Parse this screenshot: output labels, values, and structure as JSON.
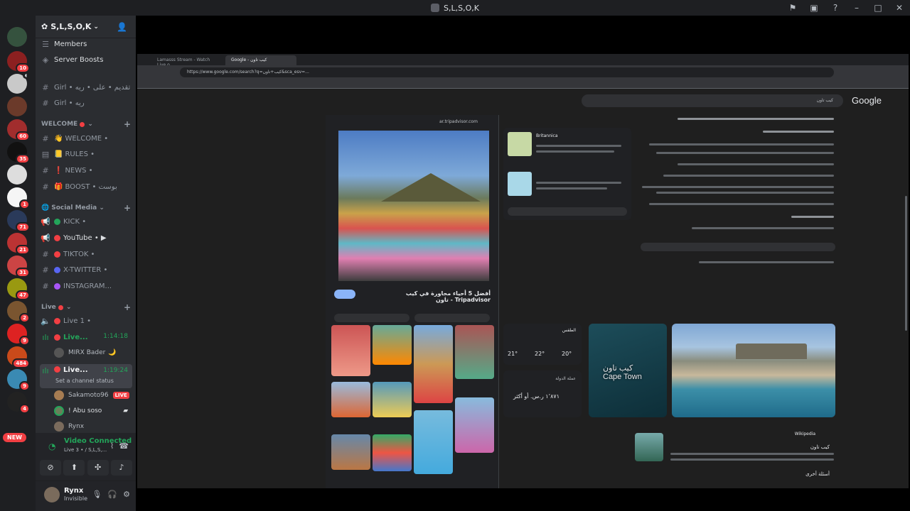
{
  "window": {
    "title": "S,L,S,O,K",
    "controls": [
      "flag-icon",
      "inbox-icon",
      "help-icon",
      "minimize-icon",
      "maximize-icon",
      "close-icon"
    ]
  },
  "guilds": [
    {
      "badge": "10"
    },
    {
      "badge": ""
    },
    {
      "badge": ""
    },
    {
      "badge": "60"
    },
    {
      "badge": "35"
    },
    {
      "badge": ""
    },
    {
      "badge": "1"
    },
    {
      "badge": "71"
    },
    {
      "badge": "21"
    },
    {
      "badge": "31"
    },
    {
      "badge": "47"
    },
    {
      "badge": "2"
    },
    {
      "badge": "9"
    },
    {
      "badge": "484"
    },
    {
      "badge": "9"
    },
    {
      "badge": "4"
    }
  ],
  "new_pill": "NEW",
  "server": {
    "name": "S,L,S,O,K",
    "members": "Members",
    "boosts": "Server Boosts"
  },
  "channels": {
    "top": [
      {
        "name": "Girl • تقديم • على • ريه"
      },
      {
        "name": "Girl • ريه"
      }
    ],
    "welcome": {
      "label": "WELCOME",
      "items": [
        {
          "name": "WELCOME •"
        },
        {
          "name": "RULES •"
        },
        {
          "name": "NEWS •"
        },
        {
          "name": "BOOST • بوست"
        }
      ]
    },
    "social": {
      "label": "Social Media",
      "items": [
        {
          "name": "KICK •",
          "color": "#23a55a"
        },
        {
          "name": "YouTube • ▶",
          "color": "#f23f43"
        },
        {
          "name": "TIKTOK •",
          "color": "#f23f43"
        },
        {
          "name": "X-TWITTER •",
          "color": "#5865f2"
        },
        {
          "name": "INSTAGRAM...",
          "color": "#a855f7"
        }
      ]
    },
    "live": {
      "label": "Live",
      "items": [
        {
          "name": "Live 1 •"
        },
        {
          "name": "Live...",
          "time": "1:14:18"
        },
        {
          "name": "Live...",
          "time": "1:19:24",
          "sub": "Set a channel status"
        }
      ],
      "users1": [
        {
          "name": "MIRX Bader"
        }
      ],
      "users2": [
        {
          "name": "Sakamoto96",
          "badge": "LIVE"
        },
        {
          "name": "! Abu soso"
        },
        {
          "name": "Rynx"
        }
      ]
    }
  },
  "voice": {
    "title": "Video Connected",
    "sub": "Live 3 • / S,L,S,..."
  },
  "user": {
    "name": "Rynx",
    "status": "Invisible"
  },
  "stream": {
    "tab_active": "Google - كيب تاون",
    "tab_other": "Lamasss Stream - Watch Live o...",
    "url": "https://www.google.com/search?q=كيب+تاون&sca_esv=...",
    "google_logo": "Google",
    "search_value": "كيب تاون",
    "source": "ar.tripadvisor.com",
    "card_title": "أفضل 5 أحياء مجاورة في كيب تاون - Tripadvisor",
    "weather_label": "الطقس",
    "temps": [
      "21°",
      "22°",
      "20°"
    ],
    "rate_label": "عملة الدولة",
    "rate_value": "١٬٨٧١ ر.س. أو أكثر",
    "map_label": "كيب تاون\nCape Town",
    "wiki_source": "Wikipedia",
    "wiki_title": "كيب تاون",
    "wiki_more": "أسئلة أخرى",
    "britannica": "Britannica"
  }
}
